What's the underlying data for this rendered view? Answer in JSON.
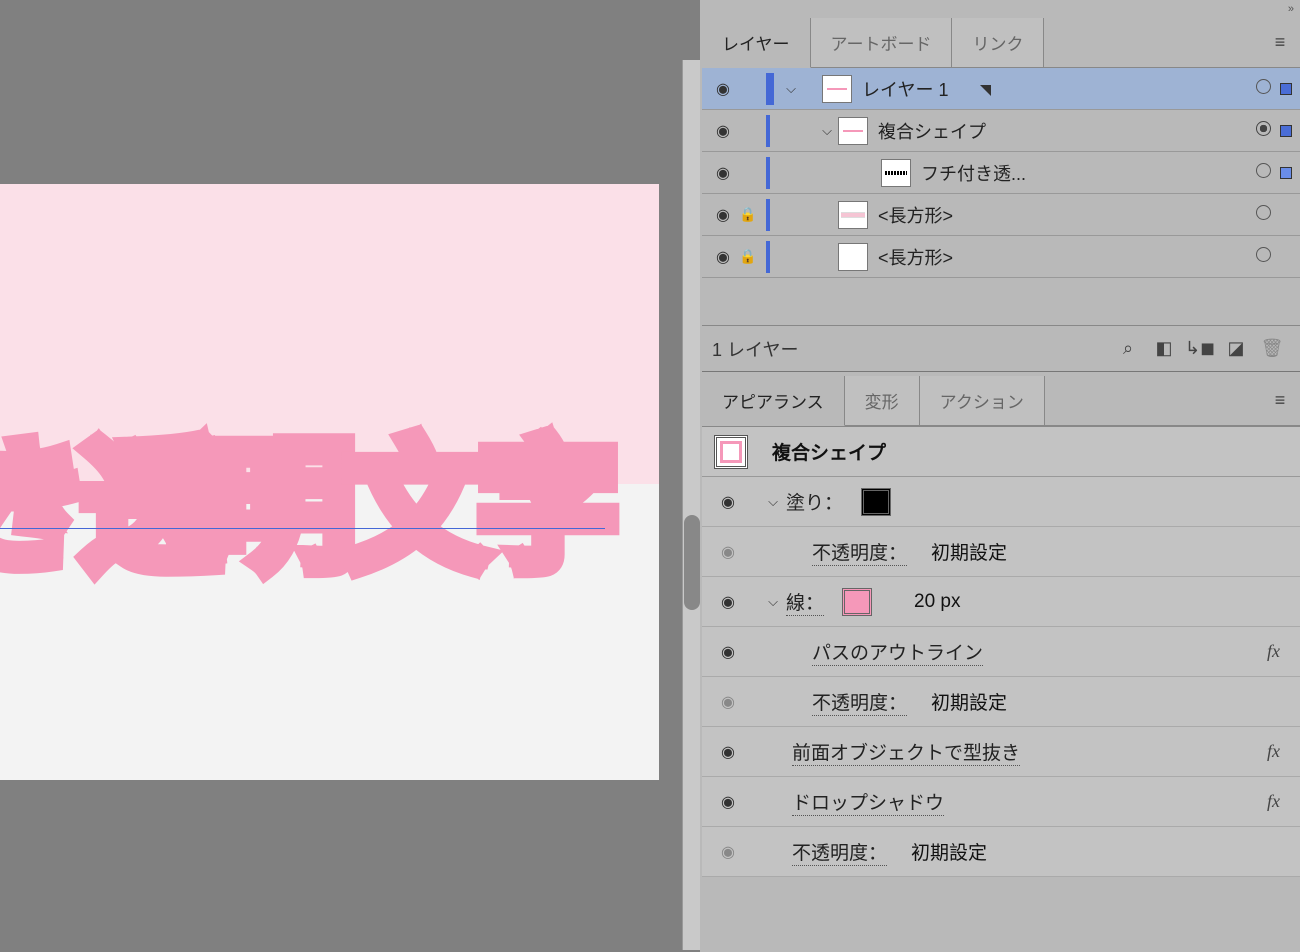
{
  "collapse": "»",
  "tabs_panel1": {
    "layers": "レイヤー",
    "artboards": "アートボード",
    "links": "リンク"
  },
  "layers": {
    "items": [
      {
        "name": "レイヤー 1"
      },
      {
        "name": "複合シェイプ"
      },
      {
        "name": "フチ付き透..."
      },
      {
        "name": "<長方形>"
      },
      {
        "name": "<長方形>"
      }
    ],
    "footer": "1 レイヤー"
  },
  "tabs_panel2": {
    "appearance": "アピアランス",
    "transform": "変形",
    "actions": "アクション"
  },
  "appearance": {
    "title": "複合シェイプ",
    "fill_label": "塗り：",
    "opacity_label": "不透明度：",
    "opacity_value": "初期設定",
    "stroke_label": "線：",
    "stroke_value": "20 px",
    "outline_path": "パスのアウトライン",
    "opacity_label2": "不透明度：",
    "opacity_value2": "初期設定",
    "knockout": "前面オブジェクトで型抜き",
    "drop_shadow": "ドロップシャドウ",
    "opacity_label3": "不透明度：",
    "opacity_value3": "初期設定"
  },
  "canvas": {
    "text": "き透明文字"
  }
}
